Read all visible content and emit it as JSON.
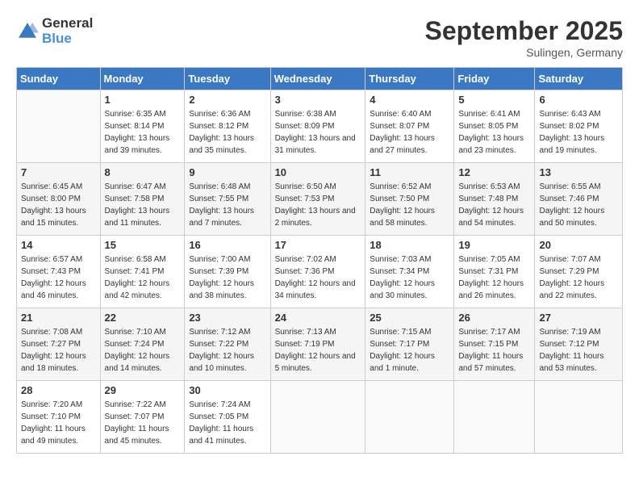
{
  "logo": {
    "text_general": "General",
    "text_blue": "Blue"
  },
  "title": "September 2025",
  "subtitle": "Sulingen, Germany",
  "days_of_week": [
    "Sunday",
    "Monday",
    "Tuesday",
    "Wednesday",
    "Thursday",
    "Friday",
    "Saturday"
  ],
  "weeks": [
    [
      {
        "day": "",
        "sunrise": "",
        "sunset": "",
        "daylight": ""
      },
      {
        "day": "1",
        "sunrise": "Sunrise: 6:35 AM",
        "sunset": "Sunset: 8:14 PM",
        "daylight": "Daylight: 13 hours and 39 minutes."
      },
      {
        "day": "2",
        "sunrise": "Sunrise: 6:36 AM",
        "sunset": "Sunset: 8:12 PM",
        "daylight": "Daylight: 13 hours and 35 minutes."
      },
      {
        "day": "3",
        "sunrise": "Sunrise: 6:38 AM",
        "sunset": "Sunset: 8:09 PM",
        "daylight": "Daylight: 13 hours and 31 minutes."
      },
      {
        "day": "4",
        "sunrise": "Sunrise: 6:40 AM",
        "sunset": "Sunset: 8:07 PM",
        "daylight": "Daylight: 13 hours and 27 minutes."
      },
      {
        "day": "5",
        "sunrise": "Sunrise: 6:41 AM",
        "sunset": "Sunset: 8:05 PM",
        "daylight": "Daylight: 13 hours and 23 minutes."
      },
      {
        "day": "6",
        "sunrise": "Sunrise: 6:43 AM",
        "sunset": "Sunset: 8:02 PM",
        "daylight": "Daylight: 13 hours and 19 minutes."
      }
    ],
    [
      {
        "day": "7",
        "sunrise": "Sunrise: 6:45 AM",
        "sunset": "Sunset: 8:00 PM",
        "daylight": "Daylight: 13 hours and 15 minutes."
      },
      {
        "day": "8",
        "sunrise": "Sunrise: 6:47 AM",
        "sunset": "Sunset: 7:58 PM",
        "daylight": "Daylight: 13 hours and 11 minutes."
      },
      {
        "day": "9",
        "sunrise": "Sunrise: 6:48 AM",
        "sunset": "Sunset: 7:55 PM",
        "daylight": "Daylight: 13 hours and 7 minutes."
      },
      {
        "day": "10",
        "sunrise": "Sunrise: 6:50 AM",
        "sunset": "Sunset: 7:53 PM",
        "daylight": "Daylight: 13 hours and 2 minutes."
      },
      {
        "day": "11",
        "sunrise": "Sunrise: 6:52 AM",
        "sunset": "Sunset: 7:50 PM",
        "daylight": "Daylight: 12 hours and 58 minutes."
      },
      {
        "day": "12",
        "sunrise": "Sunrise: 6:53 AM",
        "sunset": "Sunset: 7:48 PM",
        "daylight": "Daylight: 12 hours and 54 minutes."
      },
      {
        "day": "13",
        "sunrise": "Sunrise: 6:55 AM",
        "sunset": "Sunset: 7:46 PM",
        "daylight": "Daylight: 12 hours and 50 minutes."
      }
    ],
    [
      {
        "day": "14",
        "sunrise": "Sunrise: 6:57 AM",
        "sunset": "Sunset: 7:43 PM",
        "daylight": "Daylight: 12 hours and 46 minutes."
      },
      {
        "day": "15",
        "sunrise": "Sunrise: 6:58 AM",
        "sunset": "Sunset: 7:41 PM",
        "daylight": "Daylight: 12 hours and 42 minutes."
      },
      {
        "day": "16",
        "sunrise": "Sunrise: 7:00 AM",
        "sunset": "Sunset: 7:39 PM",
        "daylight": "Daylight: 12 hours and 38 minutes."
      },
      {
        "day": "17",
        "sunrise": "Sunrise: 7:02 AM",
        "sunset": "Sunset: 7:36 PM",
        "daylight": "Daylight: 12 hours and 34 minutes."
      },
      {
        "day": "18",
        "sunrise": "Sunrise: 7:03 AM",
        "sunset": "Sunset: 7:34 PM",
        "daylight": "Daylight: 12 hours and 30 minutes."
      },
      {
        "day": "19",
        "sunrise": "Sunrise: 7:05 AM",
        "sunset": "Sunset: 7:31 PM",
        "daylight": "Daylight: 12 hours and 26 minutes."
      },
      {
        "day": "20",
        "sunrise": "Sunrise: 7:07 AM",
        "sunset": "Sunset: 7:29 PM",
        "daylight": "Daylight: 12 hours and 22 minutes."
      }
    ],
    [
      {
        "day": "21",
        "sunrise": "Sunrise: 7:08 AM",
        "sunset": "Sunset: 7:27 PM",
        "daylight": "Daylight: 12 hours and 18 minutes."
      },
      {
        "day": "22",
        "sunrise": "Sunrise: 7:10 AM",
        "sunset": "Sunset: 7:24 PM",
        "daylight": "Daylight: 12 hours and 14 minutes."
      },
      {
        "day": "23",
        "sunrise": "Sunrise: 7:12 AM",
        "sunset": "Sunset: 7:22 PM",
        "daylight": "Daylight: 12 hours and 10 minutes."
      },
      {
        "day": "24",
        "sunrise": "Sunrise: 7:13 AM",
        "sunset": "Sunset: 7:19 PM",
        "daylight": "Daylight: 12 hours and 5 minutes."
      },
      {
        "day": "25",
        "sunrise": "Sunrise: 7:15 AM",
        "sunset": "Sunset: 7:17 PM",
        "daylight": "Daylight: 12 hours and 1 minute."
      },
      {
        "day": "26",
        "sunrise": "Sunrise: 7:17 AM",
        "sunset": "Sunset: 7:15 PM",
        "daylight": "Daylight: 11 hours and 57 minutes."
      },
      {
        "day": "27",
        "sunrise": "Sunrise: 7:19 AM",
        "sunset": "Sunset: 7:12 PM",
        "daylight": "Daylight: 11 hours and 53 minutes."
      }
    ],
    [
      {
        "day": "28",
        "sunrise": "Sunrise: 7:20 AM",
        "sunset": "Sunset: 7:10 PM",
        "daylight": "Daylight: 11 hours and 49 minutes."
      },
      {
        "day": "29",
        "sunrise": "Sunrise: 7:22 AM",
        "sunset": "Sunset: 7:07 PM",
        "daylight": "Daylight: 11 hours and 45 minutes."
      },
      {
        "day": "30",
        "sunrise": "Sunrise: 7:24 AM",
        "sunset": "Sunset: 7:05 PM",
        "daylight": "Daylight: 11 hours and 41 minutes."
      },
      {
        "day": "",
        "sunrise": "",
        "sunset": "",
        "daylight": ""
      },
      {
        "day": "",
        "sunrise": "",
        "sunset": "",
        "daylight": ""
      },
      {
        "day": "",
        "sunrise": "",
        "sunset": "",
        "daylight": ""
      },
      {
        "day": "",
        "sunrise": "",
        "sunset": "",
        "daylight": ""
      }
    ]
  ]
}
